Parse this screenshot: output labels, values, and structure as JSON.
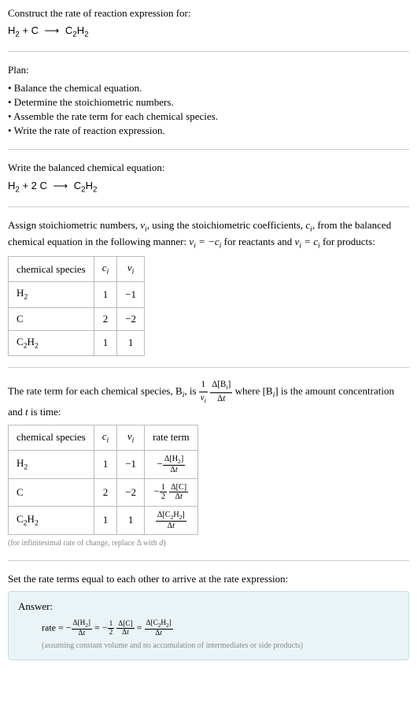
{
  "prompt": {
    "title": "Construct the rate of reaction expression for:",
    "equation": "H₂ + C ⟶ C₂H₂"
  },
  "plan": {
    "title": "Plan:",
    "items": [
      "• Balance the chemical equation.",
      "• Determine the stoichiometric numbers.",
      "• Assemble the rate term for each chemical species.",
      "• Write the rate of reaction expression."
    ]
  },
  "balanced": {
    "title": "Write the balanced chemical equation:",
    "equation": "H₂ + 2 C ⟶ C₂H₂"
  },
  "stoich": {
    "intro_1": "Assign stoichiometric numbers, ",
    "nu_i": "ν",
    "sub_i": "i",
    "intro_2": ", using the stoichiometric coefficients, ",
    "c_i": "c",
    "intro_3": ", from the balanced chemical equation in the following manner: ",
    "rel1": "νᵢ = −cᵢ",
    "intro_4": " for reactants and ",
    "rel2": "νᵢ = cᵢ",
    "intro_5": " for products:",
    "headers": [
      "chemical species",
      "cᵢ",
      "νᵢ"
    ],
    "rows": [
      {
        "species": "H₂",
        "c": "1",
        "nu": "−1"
      },
      {
        "species": "C",
        "c": "2",
        "nu": "−2"
      },
      {
        "species": "C₂H₂",
        "c": "1",
        "nu": "1"
      }
    ]
  },
  "rateterm": {
    "intro_1": "The rate term for each chemical species, B",
    "intro_2": ", is ",
    "formula_num1": "1",
    "formula_den1": "νᵢ",
    "formula_num2": "Δ[Bᵢ]",
    "formula_den2": "Δt",
    "intro_3": " where [B",
    "intro_4": "] is the amount concentration and ",
    "t_var": "t",
    "intro_5": " is time:",
    "headers": [
      "chemical species",
      "cᵢ",
      "νᵢ",
      "rate term"
    ],
    "rows": [
      {
        "species": "H₂",
        "c": "1",
        "nu": "−1",
        "rate_num": "Δ[H₂]",
        "rate_den": "Δt",
        "sign": "−",
        "coef_num": "",
        "coef_den": ""
      },
      {
        "species": "C",
        "c": "2",
        "nu": "−2",
        "rate_num": "Δ[C]",
        "rate_den": "Δt",
        "sign": "−",
        "coef_num": "1",
        "coef_den": "2"
      },
      {
        "species": "C₂H₂",
        "c": "1",
        "nu": "1",
        "rate_num": "Δ[C₂H₂]",
        "rate_den": "Δt",
        "sign": "",
        "coef_num": "",
        "coef_den": ""
      }
    ],
    "footnote": "(for infinitesimal rate of change, replace Δ with d)"
  },
  "final": {
    "intro": "Set the rate terms equal to each other to arrive at the rate expression:",
    "answer_label": "Answer:",
    "rate_label": "rate = ",
    "t1_num": "Δ[H₂]",
    "t1_den": "Δt",
    "t2_coef_num": "1",
    "t2_coef_den": "2",
    "t2_num": "Δ[C]",
    "t2_den": "Δt",
    "t3_num": "Δ[C₂H₂]",
    "t3_den": "Δt",
    "assumption": "(assuming constant volume and no accumulation of intermediates or side products)"
  }
}
